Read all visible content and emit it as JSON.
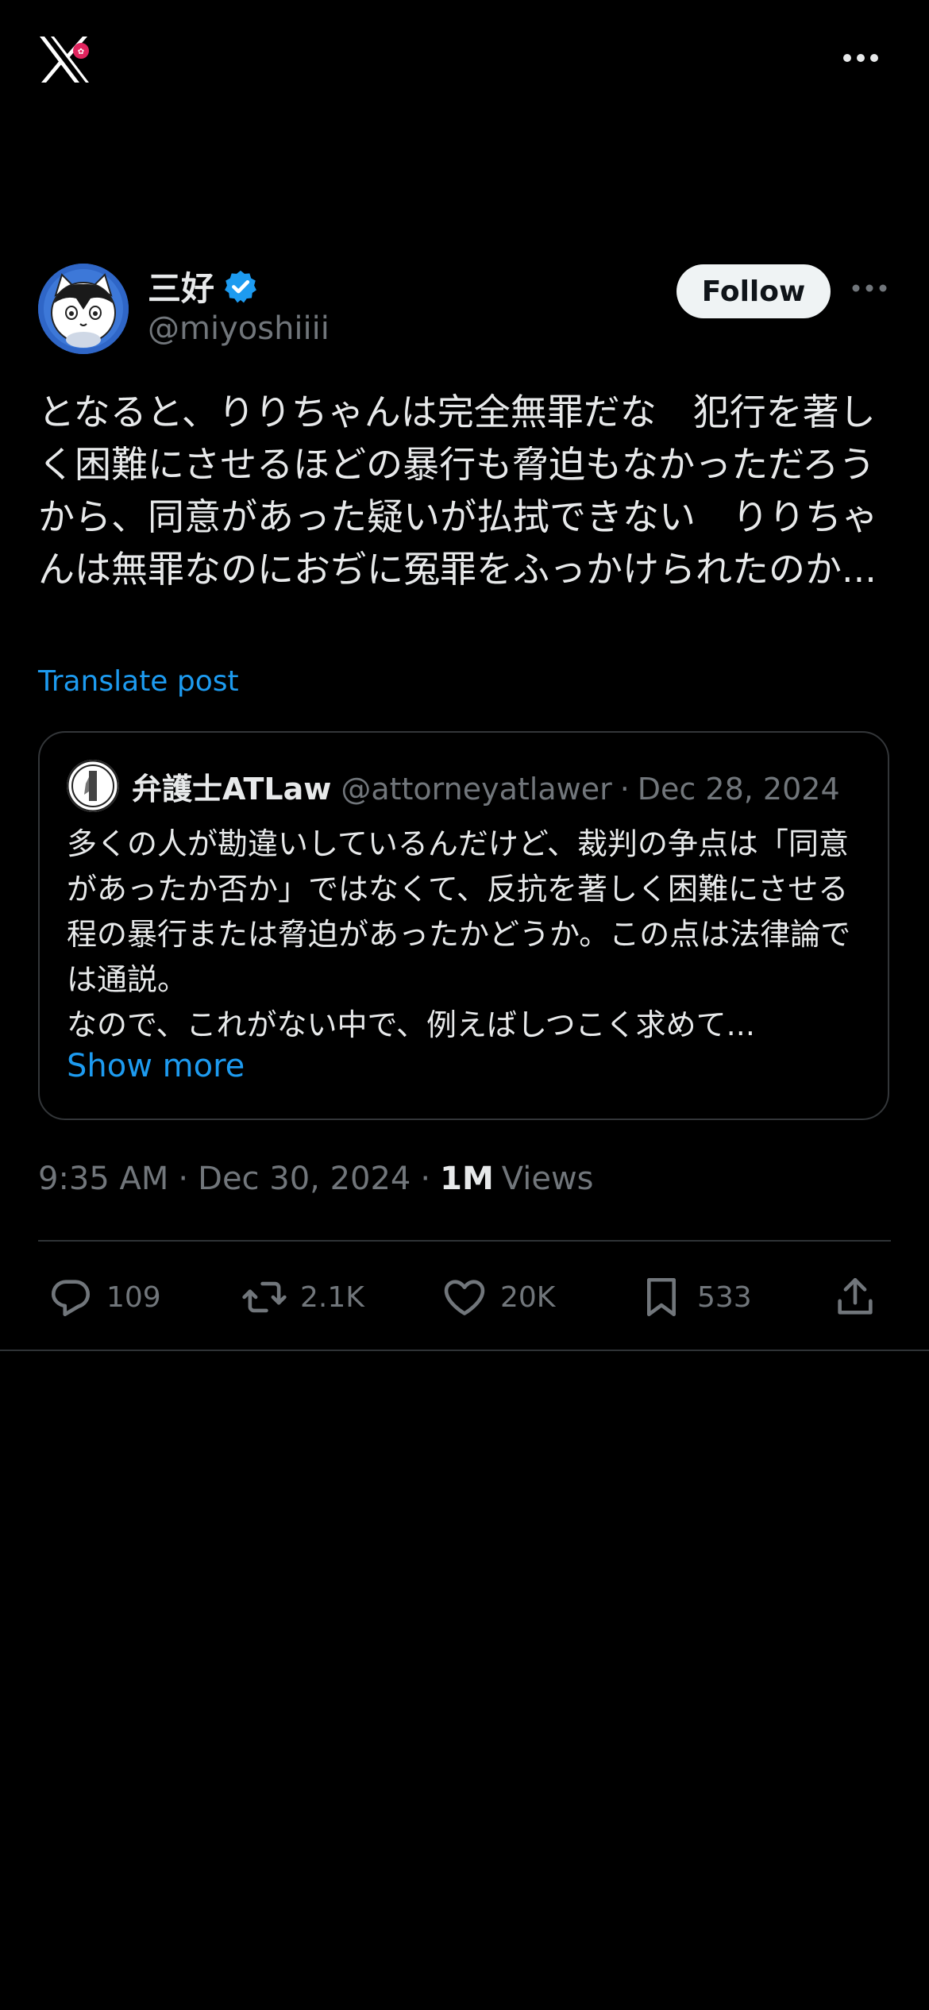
{
  "top_bar": {
    "logo_icon": "x-logo-icon",
    "more_icon": "more-horizontal-icon"
  },
  "author": {
    "name": "三好",
    "handle": "@miyoshiiii",
    "verified_icon": "verified-badge-icon",
    "follow_label": "Follow"
  },
  "post": {
    "text": "となると、りりちゃんは完全無罪だな　犯行を著しく困難にさせるほどの暴行も脅迫もなかっただろうから、同意があった疑いが払拭できない　りりちゃんは無罪なのにおぢに冤罪をふっかけられたのか...",
    "translate_label": "Translate post"
  },
  "quote": {
    "name": "弁護士ATLaw",
    "handle": "@attorneyatlawer",
    "separator": "·",
    "date": "Dec 28, 2024",
    "text": "多くの人が勘違いしているんだけど、裁判の争点は「同意があったか否か」ではなくて、反抗を著しく困難にさせる程の暴行または脅迫があったかどうか。この点は法律論では通説。",
    "text_last_line": "なので、これがない中で、例えばしつこく求めて...",
    "show_more_label": "Show more"
  },
  "meta": {
    "time": "9:35 AM",
    "date": "Dec 30, 2024",
    "separator": "·",
    "views_count": "1M",
    "views_label": "Views"
  },
  "actions": {
    "replies": "109",
    "reposts": "2.1K",
    "likes": "20K",
    "bookmarks": "533"
  },
  "colors": {
    "background": "#000000",
    "text": "#e7e9ea",
    "muted": "#71767b",
    "accent": "#1d9bf0",
    "border": "#2f3336"
  }
}
